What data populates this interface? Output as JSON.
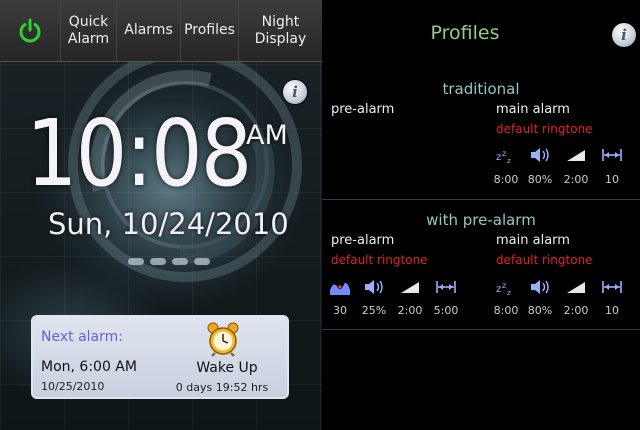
{
  "left_panel": {
    "tabs": {
      "power_icon": "power-icon",
      "quick_alarm": "Quick\nAlarm",
      "alarms": "Alarms",
      "profiles": "Profiles",
      "night_display": "Night\nDisplay"
    },
    "info_label": "i",
    "clock": {
      "time": "10:08",
      "ampm": "AM",
      "date": "Sun, 10/24/2010"
    },
    "next_alarm": {
      "label": "Next alarm:",
      "when": "Mon, 6:00 AM",
      "date": "10/25/2010",
      "name": "Wake Up",
      "remaining": "0 days 19:52 hrs",
      "icon": "alarm-clock-icon"
    }
  },
  "right_panel": {
    "title": "Profiles",
    "info_label": "i",
    "profiles": [
      {
        "name": "traditional",
        "pre_alarm_label": "pre-alarm",
        "main_alarm_label": "main alarm",
        "main_alarm_ringtone": "default ringtone",
        "main_settings": [
          {
            "icon": "snooze-icon",
            "value": "8:00"
          },
          {
            "icon": "volume-icon",
            "value": "80%"
          },
          {
            "icon": "volume-ramp-icon",
            "value": "2:00"
          },
          {
            "icon": "interval-icon",
            "value": "10"
          }
        ]
      },
      {
        "name": "with pre-alarm",
        "pre_alarm_label": "pre-alarm",
        "pre_alarm_ringtone": "default ringtone",
        "main_alarm_label": "main alarm",
        "main_alarm_ringtone": "default ringtone",
        "pre_settings": [
          {
            "icon": "sleep-cycle-icon",
            "value": "30"
          },
          {
            "icon": "volume-icon",
            "value": "25%"
          },
          {
            "icon": "volume-ramp-icon",
            "value": "2:00"
          },
          {
            "icon": "interval-icon",
            "value": "5:00"
          }
        ],
        "main_settings": [
          {
            "icon": "snooze-icon",
            "value": "8:00"
          },
          {
            "icon": "volume-icon",
            "value": "80%"
          },
          {
            "icon": "volume-ramp-icon",
            "value": "2:00"
          },
          {
            "icon": "interval-icon",
            "value": "10"
          }
        ]
      }
    ]
  },
  "colors": {
    "accent_green": "#8fd083",
    "profile_name": "#8fc9c6",
    "ringtone_red": "#e22424",
    "next_alarm_label": "#6a63c9",
    "power_green": "#2fd12f"
  }
}
